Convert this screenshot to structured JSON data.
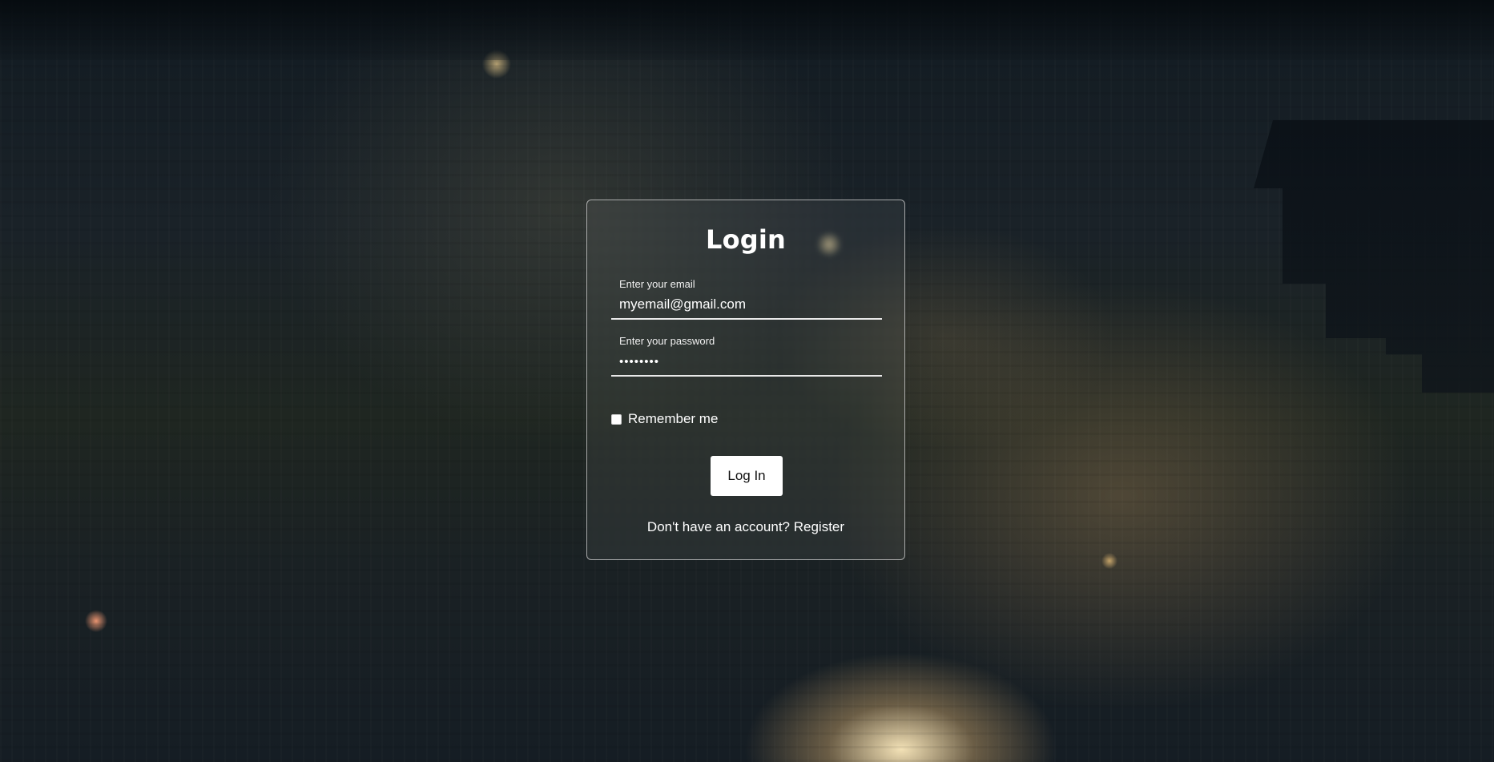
{
  "login": {
    "title": "Login",
    "email": {
      "label": "Enter your email",
      "value": "myemail@gmail.com"
    },
    "password": {
      "label": "Enter your password",
      "value": "••••••••"
    },
    "remember_me": {
      "label": "Remember me",
      "checked": false
    },
    "login_button_label": "Log In",
    "register_prompt": "Don't have an account?",
    "register_link_label": "Register"
  }
}
